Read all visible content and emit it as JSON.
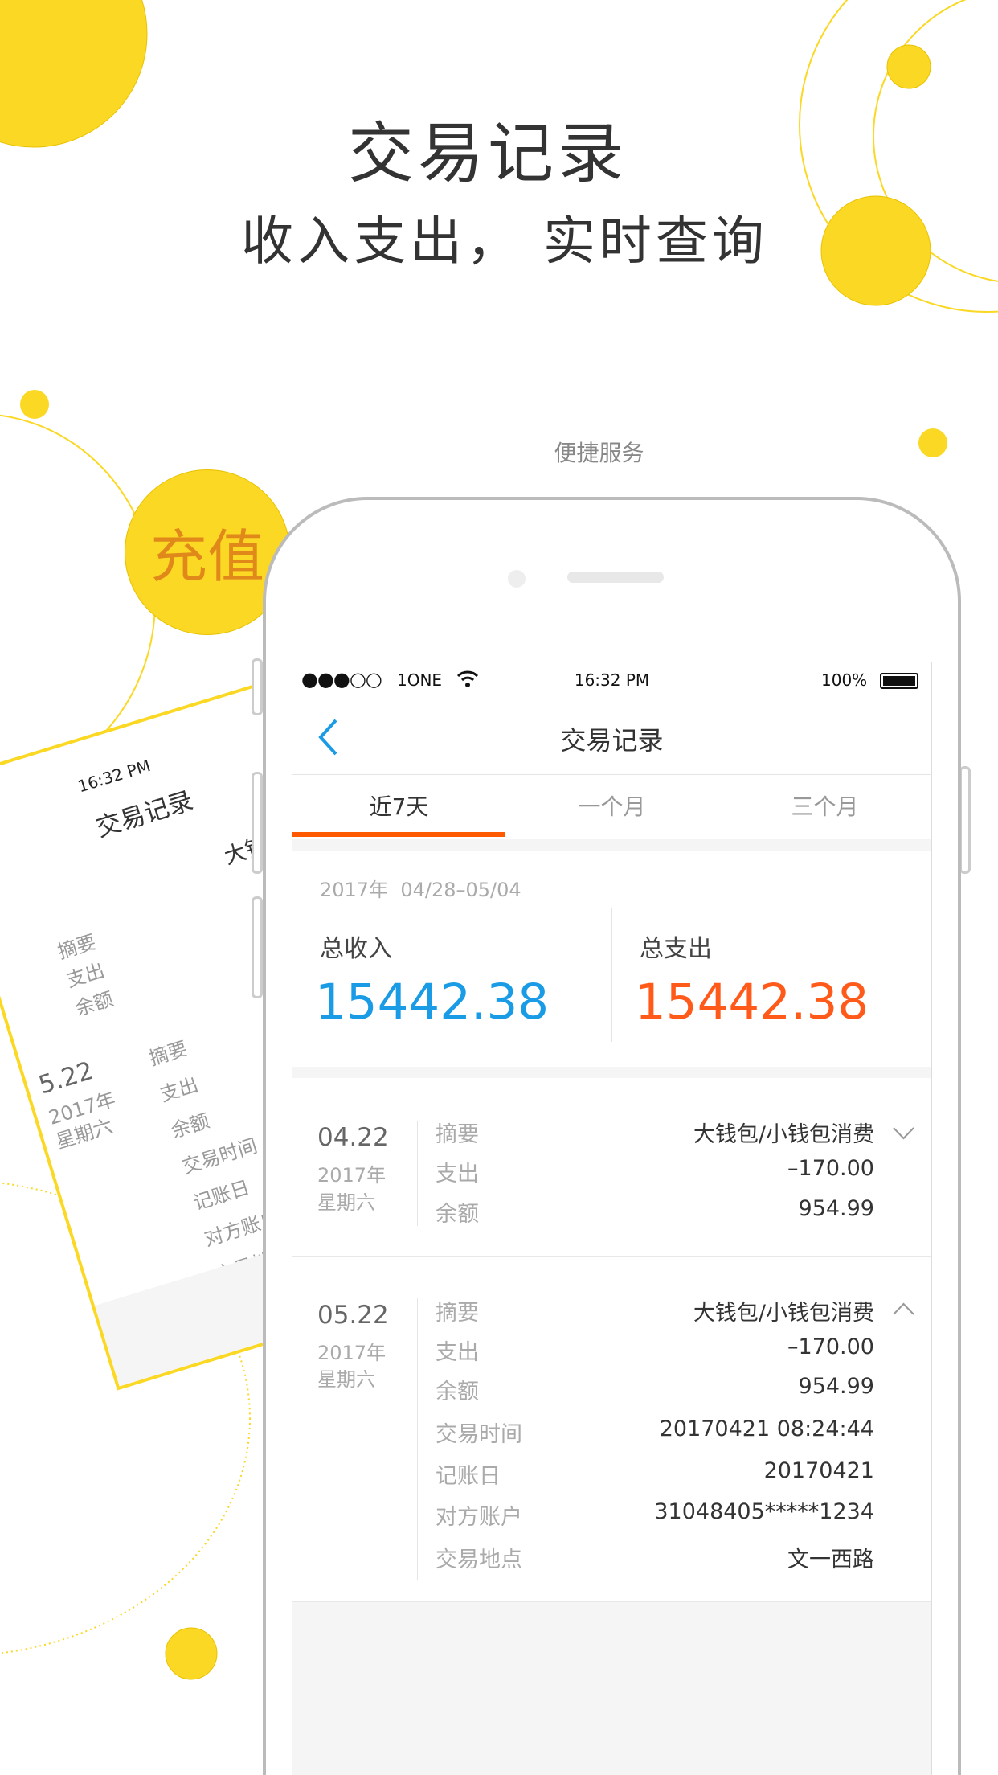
{
  "promo": {
    "title": "交易记录",
    "subtitle": "收入支出， 实时查询",
    "service_label": "便捷服务",
    "recharge_label": "充值"
  },
  "colors": {
    "accent_yellow": "#fbd824",
    "income_blue": "#1a9be6",
    "expense_orange": "#ff5a1a",
    "tab_underline": "#ff5a00"
  },
  "status_bar": {
    "signal": "●●●○○",
    "carrier": "1ONE",
    "time": "16:32 PM",
    "battery": "100%"
  },
  "nav": {
    "title": "交易记录",
    "back_icon": "chevron-left"
  },
  "tabs": [
    {
      "label": "近7天",
      "active": true
    },
    {
      "label": "一个月"
    },
    {
      "label": "三个月"
    }
  ],
  "summary": {
    "date_range": "2017年  04/28–05/04",
    "income_label": "总收入",
    "income_value": "15442.38",
    "expense_label": "总支出",
    "expense_value": "15442.38"
  },
  "transactions": [
    {
      "date": "04.22",
      "year": "2017年",
      "weekday": "星期六",
      "expanded": false,
      "rows": [
        {
          "k": "摘要",
          "v": "大钱包/小钱包消费"
        },
        {
          "k": "支出",
          "v": "–170.00"
        },
        {
          "k": "余额",
          "v": "954.99"
        }
      ]
    },
    {
      "date": "05.22",
      "year": "2017年",
      "weekday": "星期六",
      "expanded": true,
      "rows": [
        {
          "k": "摘要",
          "v": "大钱包/小钱包消费"
        },
        {
          "k": "支出",
          "v": "–170.00"
        },
        {
          "k": "余额",
          "v": "954.99"
        },
        {
          "k": "交易时间",
          "v": "20170421 08:24:44"
        },
        {
          "k": "记账日",
          "v": "20170421"
        },
        {
          "k": "对方账户",
          "v": "31048405*****1234"
        },
        {
          "k": "交易地点",
          "v": "文一西路"
        }
      ]
    }
  ],
  "bg_card": {
    "time": "16:32 PM",
    "title": "交易记录",
    "summary_value": "大钱包/小",
    "labels_short": [
      "摘要",
      "支出",
      "余额"
    ],
    "date": "5.22",
    "year": "2017年",
    "weekday": "星期六",
    "labels_long": [
      "摘要",
      "支出",
      "余额",
      "交易时间",
      "记账日",
      "对方账户",
      "交易地点"
    ]
  }
}
